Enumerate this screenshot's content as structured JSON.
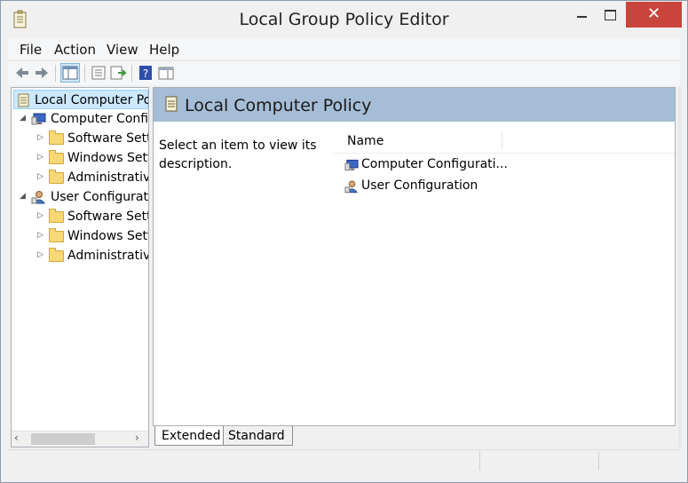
{
  "window": {
    "title": "Local Group Policy Editor",
    "close_glyph": "✕"
  },
  "menu": [
    "File",
    "Action",
    "View",
    "Help"
  ],
  "toolbar": {
    "icons": [
      "back-icon",
      "forward-icon",
      "show-hide-tree-icon",
      "properties-icon",
      "export-list-icon",
      "help-icon",
      "show-hide-action-pane-icon"
    ]
  },
  "tree": {
    "root": "Local Computer Policy",
    "computer_config": "Computer Configuration",
    "user_config": "User Configuration",
    "children": {
      "software": "Software Settings",
      "windows": "Windows Settings",
      "admin": "Administrative Templates"
    }
  },
  "detail": {
    "title": "Local Computer Policy",
    "description": "Select an item to view its description.",
    "column_name": "Name",
    "items": [
      "Computer Configurati...",
      "User Configuration"
    ]
  },
  "tabs": [
    "Extended",
    "Standard"
  ],
  "colors": {
    "header": "#a5bdd6",
    "close": "#c9453c",
    "selection": "#cce8ff"
  }
}
